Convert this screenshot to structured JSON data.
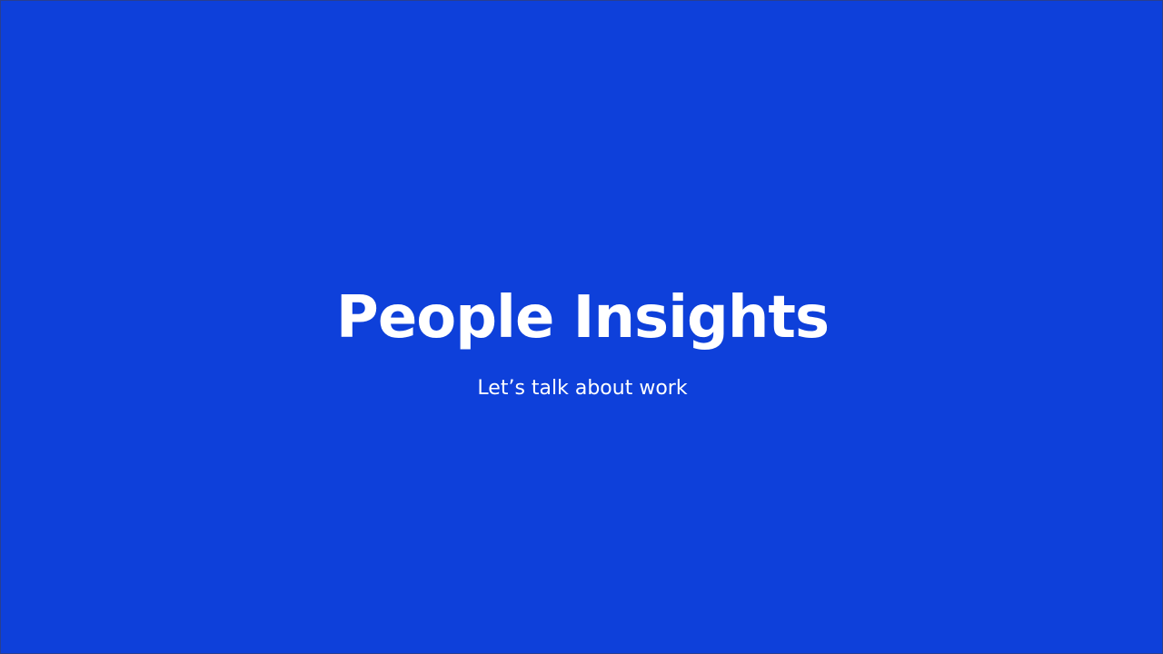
{
  "slide": {
    "title": "People Insights",
    "subtitle": "Let’s talk about work"
  }
}
